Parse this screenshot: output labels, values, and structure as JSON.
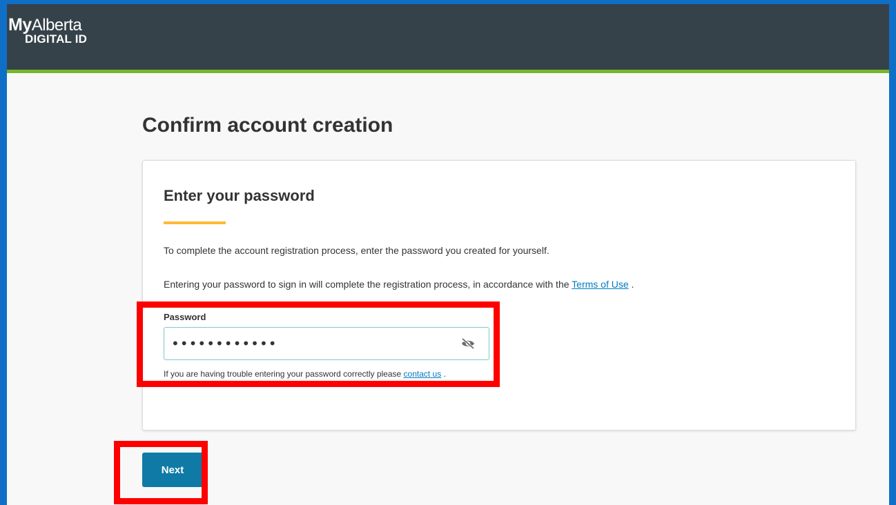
{
  "header": {
    "logo_my": "My",
    "logo_alberta": "Alberta",
    "logo_sub": "DIGITAL ID"
  },
  "page": {
    "title": "Confirm account creation"
  },
  "card": {
    "title": "Enter your password",
    "paragraph1": "To complete the account registration process, enter the password you created for yourself.",
    "paragraph2_prefix": "Entering your password to sign in will complete the registration process, in accordance with the ",
    "paragraph2_link": "Terms of Use",
    "paragraph2_suffix": " ."
  },
  "password_field": {
    "label": "Password",
    "value": "••••••••••••",
    "visibility_icon": "eye-slash-icon",
    "help_prefix": "If you are having trouble entering your password correctly please ",
    "help_link": "contact us",
    "help_suffix": " ."
  },
  "actions": {
    "next_label": "Next"
  },
  "colors": {
    "frame_border": "#0f6fc6",
    "header_bg": "#36424a",
    "header_accent": "#77b82a",
    "title_underline": "#feba35",
    "button_bg": "#0f7aa6",
    "link": "#0079c1",
    "annotation_highlight": "#ff0000"
  }
}
